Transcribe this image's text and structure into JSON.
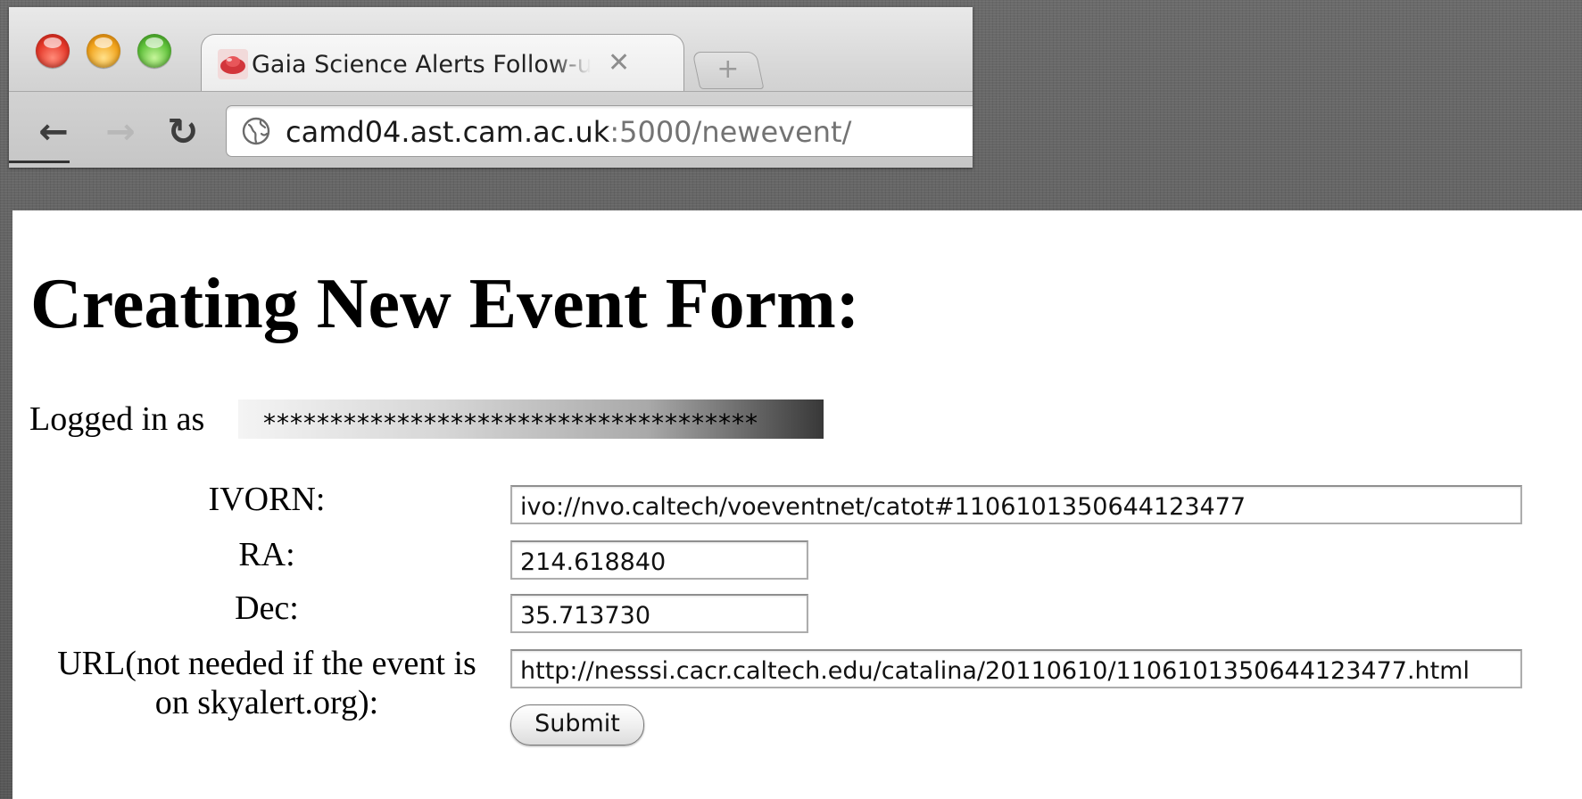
{
  "browser": {
    "tab": {
      "title": "Gaia Science Alerts Follow-up",
      "close_glyph": "✕",
      "favicon": "gaia-favicon-icon"
    },
    "new_tab_glyph": "+",
    "nav": {
      "back_glyph": "←",
      "forward_glyph": "→",
      "reload_glyph": "↻"
    },
    "address": {
      "host": "camd04.ast.cam.ac.uk",
      "rest": ":5000/newevent/",
      "icon": "globe-icon"
    }
  },
  "page": {
    "title": "Creating New Event Form:",
    "logged_in_prefix": "Logged in as ",
    "logged_in_user": "*************************************",
    "form": {
      "ivorn_label": "IVORN:",
      "ivorn_value": "ivo://nvo.caltech/voeventnet/catot#1106101350644123477",
      "ra_label": "RA:",
      "ra_value": "214.618840",
      "dec_label": "Dec:",
      "dec_value": "35.713730",
      "url_label": "URL(not needed if the event is on skyalert.org):",
      "url_value": "http://nesssi.cacr.caltech.edu/catalina/20110610/1106101350644123477.html",
      "submit_label": "Submit"
    }
  }
}
